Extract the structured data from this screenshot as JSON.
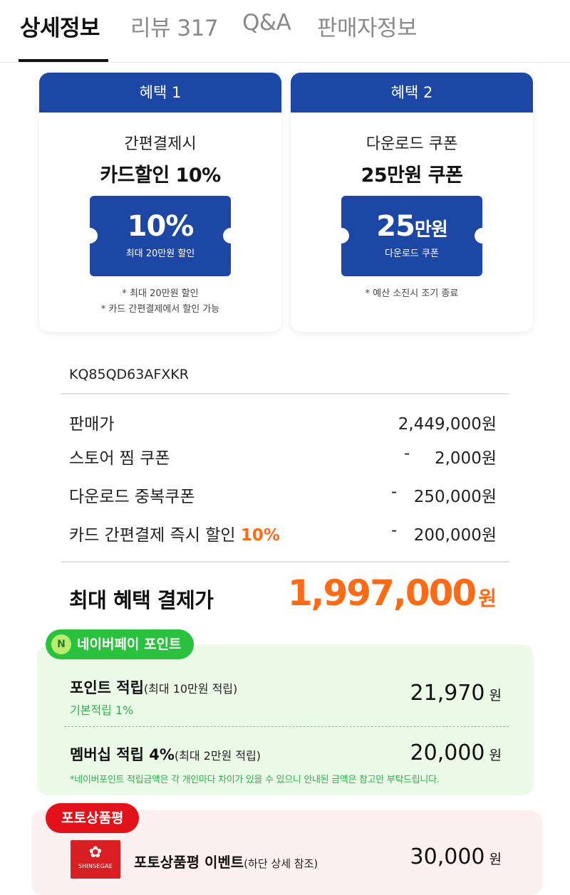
{
  "tabs": [
    {
      "label": "상세정보",
      "active": true
    },
    {
      "label": "리뷰 317",
      "active": false
    },
    {
      "label": "Q&A",
      "active": false
    },
    {
      "label": "판매자정보",
      "active": false
    }
  ],
  "benefits": [
    {
      "header": "혜택 1",
      "subtitle": "간편결제시",
      "title": "카드할인 10%",
      "coupon_value": "10%",
      "coupon_unit": "",
      "coupon_caption": "최대 20만원 할인",
      "notes": [
        "* 최대 20만원 할인",
        "* 카드 간편결제에서 할인 가능"
      ]
    },
    {
      "header": "혜택 2",
      "subtitle": "다운로드 쿠폰",
      "title": "25만원 쿠폰",
      "coupon_value": "25",
      "coupon_unit": "만원",
      "coupon_caption": "다운로드 쿠폰",
      "notes": [
        "* 예산 소진시 조기 종료"
      ]
    }
  ],
  "model_code": "KQ85QD63AFXKR",
  "price_rows": [
    {
      "label": "판매가",
      "highlight": "",
      "minus": "",
      "value": "2,449,000원"
    },
    {
      "label": "스토어 찜 쿠폰",
      "highlight": "",
      "minus": "-",
      "value": "2,000원"
    },
    {
      "label": "다운로드 중복쿠폰",
      "highlight": "",
      "minus": "-",
      "value": "250,000원"
    },
    {
      "label": "카드 간편결제 즉시 할인 ",
      "highlight": "10%",
      "minus": "-",
      "value": "200,000원"
    }
  ],
  "final": {
    "label": "최대 혜택 결제가",
    "value": "1,997,000",
    "unit": "원"
  },
  "naverpay": {
    "badge": "네이버페이 포인트",
    "icon_text": "N",
    "point": {
      "title": "포인트 적립",
      "paren": "(최대 10만원 적립)",
      "sub": "기본적립 1%",
      "value": "21,970",
      "unit": "원"
    },
    "membership": {
      "title": "멤버십 적립 4%",
      "paren": "(최대 2만원 적립)",
      "value": "20,000",
      "unit": "원"
    },
    "note": "*네이버포인트 적립금액은 각 개인마다 차이가 있을 수 있으니 안내된 금액은 참고만 부탁드립니다."
  },
  "photo_review": {
    "badge": "포토상품평",
    "logo_text": "SHINSEGAE",
    "title": "포토상품평 이벤트",
    "paren": "(하단 상세 참조)",
    "value": "30,000",
    "unit": "원"
  },
  "colors": {
    "brand_blue": "#1d47a5",
    "accent_orange": "#ff6a14",
    "naver_green": "#2ac13e",
    "red": "#e3121a"
  }
}
